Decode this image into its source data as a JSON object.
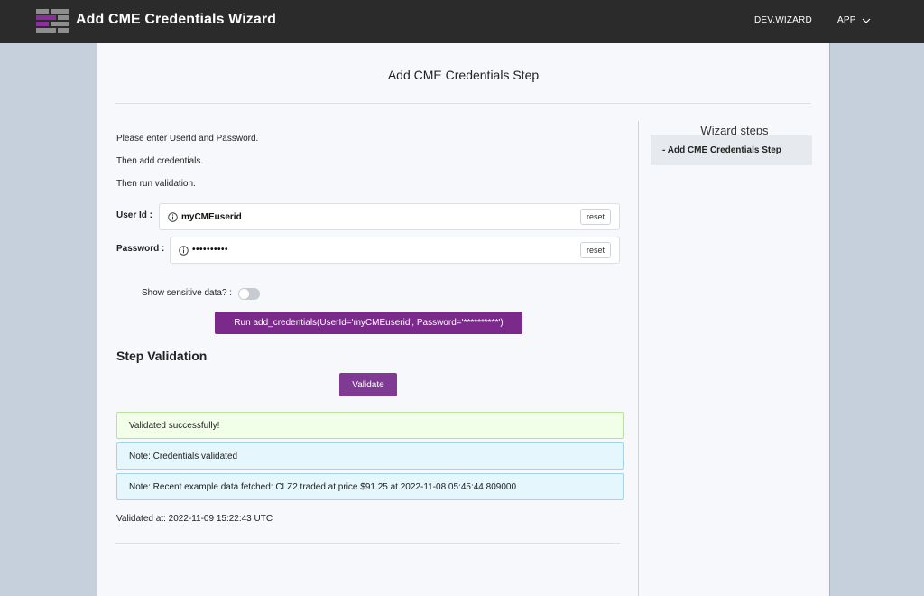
{
  "header": {
    "title": "Add CME Credentials Wizard",
    "nav_dev": "DEV.WIZARD",
    "nav_app": "APP",
    "brand_color": "#7b2a8c"
  },
  "step": {
    "title": "Add CME Credentials Step",
    "instructions": [
      "Please enter UserId and Password.",
      "Then add credentials.",
      "Then run validation."
    ]
  },
  "form": {
    "userid_label": "User Id :",
    "userid_value": "myCMEuserid",
    "password_label": "Password :",
    "password_value": "••••••••••",
    "reset_label": "reset",
    "toggle_label": "Show sensitive data? :",
    "toggle_on": false,
    "run_button": "Run add_credentials(UserId='myCMEuserid', Password='**********')"
  },
  "validation": {
    "title": "Step Validation",
    "validate_button": "Validate",
    "success": "Validated successfully!",
    "note1": "Note: Credentials validated",
    "note2": "Note: Recent example data fetched: CLZ2 traded at price $91.25 at 2022-11-08 05:45:44.809000",
    "validated_at": "Validated at: 2022-11-09 15:22:43 UTC"
  },
  "sidebar": {
    "title": "Wizard steps",
    "items": [
      {
        "label": "- Add CME Credentials Step"
      }
    ]
  }
}
